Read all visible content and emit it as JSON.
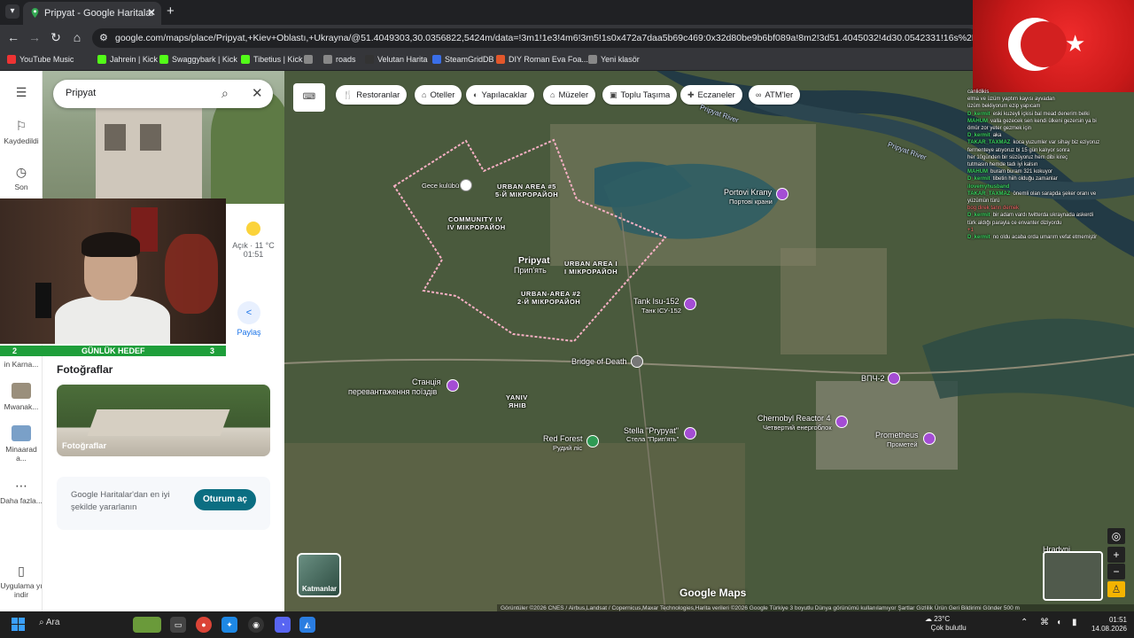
{
  "browser": {
    "tab_title": "Pripyat - Google Haritalar",
    "tab_close": "✕",
    "new_tab": "+",
    "url": "google.com/maps/place/Pripyat,+Kiev+Oblastı,+Ukrayna/@51.4049303,30.0356822,5424m/data=!3m1!1e3!4m6!3m5!1s0x472a7daa5b69c469:0x32d80be9b6bf089a!8m2!3d51.4045032!4d30.0542331!16s%2Fg%2F12yygpv81?entry=ttu&",
    "bookmarks": [
      {
        "label": "YouTube Music",
        "color": "#e33"
      },
      {
        "label": "Jahrein | Kick",
        "color": "#53fc18"
      },
      {
        "label": "Swaggybark | Kick",
        "color": "#53fc18"
      },
      {
        "label": "Tibetius | Kick",
        "color": "#53fc18"
      },
      {
        "label": "",
        "color": "#888"
      },
      {
        "label": "roads",
        "color": "#888"
      },
      {
        "label": "Velutan Harita",
        "color": "#333"
      },
      {
        "label": "SteamGridDB",
        "color": "#3a6ee8"
      },
      {
        "label": "DIY Roman Eva Foa...",
        "color": "#e2572b"
      },
      {
        "label": "Yeni klasör",
        "color": "#888"
      }
    ]
  },
  "maps": {
    "search_value": "Pripyat",
    "rail": {
      "saved": "Kaydedildi",
      "recent": "Son",
      "karna": "in Karna...",
      "mwanak": "Mwanak...",
      "minaarad": "Minaarad a...",
      "more": "Daha fazla...",
      "download": "Uygulama yı indir"
    },
    "weather": {
      "condition": "Açık · 11 °C",
      "time": "01:51"
    },
    "share_label": "Paylaş",
    "photos_heading": "Fotoğraflar",
    "photos_label": "Fotoğraflar",
    "signin_text": "Google Haritalar'dan en iyi şekilde yararlanın",
    "signin_button": "Oturum aç",
    "goal": {
      "left": "2",
      "text": "GÜNLÜK HEDEF",
      "right": "3"
    },
    "chips": [
      "Restoranlar",
      "Oteller",
      "Yapılacaklar",
      "Müzeler",
      "Toplu Taşıma",
      "Eczaneler",
      "ATM'ler"
    ],
    "layers_label": "Katmanlar",
    "logo": "Google Maps",
    "attribution": "Görüntüler ©2026 CNES / Airbus,Landsat / Copernicus,Maxar Technologies,Harita verileri ©2026 Google   Türkiye   3 boyutlu Dünya görünümü kullanılamıyor   Şartlar   Gizlilik   Ürün Geri Bildirimi Gönder   500 m"
  },
  "map_labels": {
    "river1": "Pripyat River",
    "river2": "Pripyat River",
    "club": "Gece kulübü",
    "ua5": "URBAN AREA #5",
    "ua5_local": "5-Й МІКРОРАЙОН",
    "c4": "COMMUNITY IV",
    "c4_local": "IV МІКРОРАЙОН",
    "city": "Pripyat",
    "city_local": "Прип'ять",
    "ua1": "URBAN AREA I",
    "ua1_local": "I МІКРОРАЙОН",
    "ua2": "URBAN-AREA #2",
    "ua2_local": "2-Й МІКРОРАЙОН",
    "portovi": "Portovi Krany",
    "portovi_local": "Портові крани",
    "tank": "Tank Isu-152",
    "tank_local": "Танк ІСУ-152",
    "bridge": "Bridge of Death",
    "station": "Станція",
    "station2": "перевантаження поїздів",
    "yaniv": "YANIV",
    "yaniv_local": "ЯНІВ",
    "vpch": "ВПЧ-2",
    "reactor": "Chernobyl Reactor 4",
    "reactor_local": "Четвертий енергоблок",
    "stella": "Stella \"Prypyat\"",
    "stella_local": "Стела \"Прип'ять\"",
    "redforest": "Red Forest",
    "redforest_local": "Рудий ліс",
    "prometheus": "Prometheus",
    "prometheus_local": "Прометей",
    "hradyni": "Hradyni"
  },
  "chat": [
    {
      "user": "",
      "text": "canlidikis"
    },
    {
      "user": "",
      "text": "elma ve üzüm yaptım kayısı ayvadan"
    },
    {
      "user": "",
      "text": "üzüm bekliyorum ezip yapıcam"
    },
    {
      "user": "D_kermit",
      "text": "eski kuzeyli içkisi bal mead denerim belki"
    },
    {
      "user": "MAHUM",
      "text": "valla gezecek sen kendi ülkeni gezersin ya bi"
    },
    {
      "user": "",
      "text": "ömür zor yeter gezmek için"
    },
    {
      "user": "D_kermit",
      "text": "aka"
    },
    {
      "user": "TAKAR_TAXMAZ",
      "text": "koca yuzumler var sihay biz eziyoruz"
    },
    {
      "user": "",
      "text": "fermenteye atıyoruz bi 15 gün kalıyor sonra"
    },
    {
      "user": "",
      "text": "her 10günden bir süzüyoruz hem dibi kireç"
    },
    {
      "user": "",
      "text": "tutmasın hemde tadı iyi kalsın"
    },
    {
      "user": "MAHUM",
      "text": "buram buram 321 kokuyor"
    },
    {
      "user": "D_kermit",
      "text": "tibetin hiih olduğu zamanlar"
    },
    {
      "user": "ilovemyhusband",
      "text": ""
    },
    {
      "user": "TAKAR_TAXMAZ",
      "text": "önemli olan sarapda şeker oranı ve"
    },
    {
      "user": "",
      "text": "yüzümün türü"
    },
    {
      "user": "",
      "text": "bog direk tanrı demek",
      "red": true
    },
    {
      "user": "D_kermit",
      "text": "bir adam vardı twitterda ukraynada askerdi"
    },
    {
      "user": "",
      "text": "türk aldığı parayla ce envanter diziyordu"
    },
    {
      "user": "",
      "text": "+1",
      "red": true
    },
    {
      "user": "D_kermit",
      "text": "no oldu acaba orda umarım vefat etmemiştir"
    }
  ],
  "taskbar": {
    "search": "Ara",
    "weather_temp": "23°C",
    "weather_text": "Çok bulutlu",
    "time": "01:51",
    "date": "14.08.2026"
  }
}
